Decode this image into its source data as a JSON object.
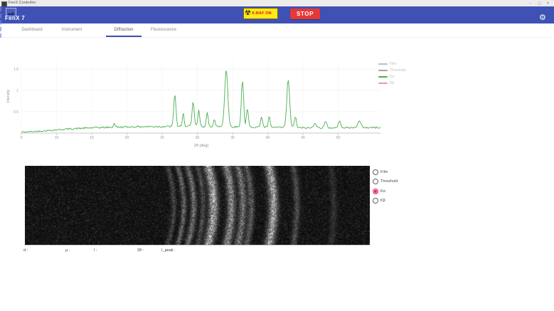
{
  "window": {
    "title": "FenX Controller",
    "minimize_glyph": "–",
    "maximize_glyph": "▢",
    "close_glyph": "✕"
  },
  "header": {
    "app_title": "FenX 7",
    "xray_label": "X-RAY ON",
    "stop_label": "STOP",
    "icons": {
      "gear": "⚙",
      "radiation": "☢",
      "app_logo": "mountains-image-icon"
    },
    "colors": {
      "bar": "#3f51b5",
      "xray_bg": "#ffe81a",
      "xray_text": "#d81410",
      "stop_bg": "#e53935"
    }
  },
  "tabs": {
    "items": [
      {
        "label": "Dashboard",
        "active": false
      },
      {
        "label": "Instrument",
        "active": false
      },
      {
        "label": "Diffraction",
        "active": true
      },
      {
        "label": "Fluorescence",
        "active": false
      }
    ],
    "underline_color": "#3f51b5"
  },
  "chart_data": {
    "type": "line",
    "title": "",
    "xlabel": "2θ (deg)",
    "ylabel": "Intensity",
    "xlim": [
      5,
      56
    ],
    "ylim": [
      0,
      1.7
    ],
    "xticks": [
      5,
      10,
      15,
      20,
      25,
      30,
      35,
      40,
      45,
      50
    ],
    "yticks": [
      0.5,
      1,
      1.5
    ],
    "grid": true,
    "legend_position": "top-right",
    "legend": [
      {
        "label": "Film",
        "color": "#9fc5e8"
      },
      {
        "label": "Threshold",
        "color": "#b3a38e"
      },
      {
        "label": "Kα",
        "color": "#4caf50"
      },
      {
        "label": "Kβ",
        "color": "#f19999"
      }
    ],
    "visible_series": "Kα",
    "line_color": "#4caf50",
    "noise_amplitude": 0.016,
    "seed": 42,
    "baseline": [
      [
        5,
        0.02
      ],
      [
        8,
        0.05
      ],
      [
        12,
        0.1
      ],
      [
        16,
        0.13
      ],
      [
        22,
        0.15
      ],
      [
        30,
        0.16
      ],
      [
        38,
        0.14
      ],
      [
        46,
        0.12
      ],
      [
        56,
        0.13
      ]
    ],
    "peaks": [
      [
        18.2,
        0.1,
        0.1
      ],
      [
        26.8,
        0.78,
        0.15
      ],
      [
        28.0,
        0.3,
        0.12
      ],
      [
        29.4,
        0.55,
        0.15
      ],
      [
        30.2,
        0.35,
        0.13
      ],
      [
        31.4,
        0.3,
        0.13
      ],
      [
        32.4,
        0.18,
        0.12
      ],
      [
        34.1,
        1.38,
        0.22
      ],
      [
        36.4,
        1.12,
        0.16
      ],
      [
        37.1,
        0.42,
        0.14
      ],
      [
        39.1,
        0.25,
        0.14
      ],
      [
        40.2,
        0.24,
        0.13
      ],
      [
        42.9,
        1.12,
        0.2
      ],
      [
        43.9,
        0.26,
        0.14
      ],
      [
        46.7,
        0.13,
        0.18
      ],
      [
        48.2,
        0.14,
        0.18
      ],
      [
        50.2,
        0.14,
        0.2
      ],
      [
        53.0,
        0.14,
        0.25
      ]
    ]
  },
  "film": {
    "seed": 7,
    "arcs": [
      [
        200,
        0.3,
        2.5,
        9
      ],
      [
        214,
        0.5,
        2.5,
        9
      ],
      [
        228,
        0.55,
        3.0,
        9
      ],
      [
        242,
        0.35,
        2.5,
        8
      ],
      [
        257,
        0.95,
        4.5,
        8
      ],
      [
        283,
        0.75,
        4.0,
        7
      ],
      [
        299,
        0.6,
        3.5,
        7
      ],
      [
        311,
        0.45,
        3.0,
        7
      ],
      [
        343,
        0.9,
        4.5,
        6
      ],
      [
        377,
        0.35,
        3.0,
        5
      ],
      [
        430,
        0.18,
        3.0,
        4
      ]
    ]
  },
  "film_controls": {
    "selected_color": "#e91e63",
    "options": [
      {
        "label": "Film",
        "selected": false
      },
      {
        "label": "Threshold",
        "selected": false
      },
      {
        "label": "Kα",
        "selected": true
      },
      {
        "label": "Kβ",
        "selected": false
      }
    ]
  },
  "readouts": {
    "items": [
      "d :",
      "μ :",
      "I :",
      "2θ :",
      "I_peak :"
    ]
  }
}
